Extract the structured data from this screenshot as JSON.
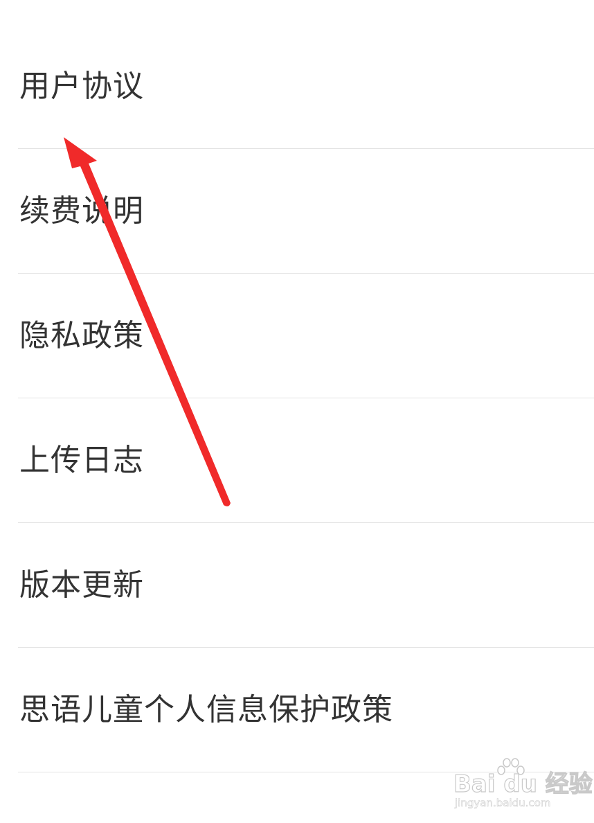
{
  "settings": {
    "items": [
      {
        "label": "用户协议"
      },
      {
        "label": "续费说明"
      },
      {
        "label": "隐私政策"
      },
      {
        "label": "上传日志"
      },
      {
        "label": "版本更新"
      },
      {
        "label": "思语儿童个人信息保护政策"
      }
    ]
  },
  "annotation": {
    "type": "arrow",
    "color": "#f02a2a",
    "points_to": "用户协议"
  },
  "watermark": {
    "brand": "Bai du 经验",
    "url": "jingyan.baidu.com"
  },
  "colors": {
    "background": "#ffffff",
    "text": "#333333",
    "divider": "#e3e3e3"
  }
}
